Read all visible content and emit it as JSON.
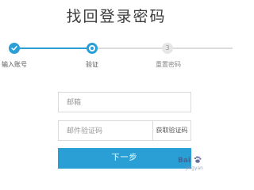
{
  "page": {
    "title": "找回登录密码"
  },
  "steps": [
    {
      "label": "输入账号",
      "state": "done",
      "icon": "check-icon"
    },
    {
      "label": "验证",
      "state": "active"
    },
    {
      "label": "重置密码",
      "state": "pending",
      "number": "3"
    }
  ],
  "form": {
    "email_placeholder": "邮箱",
    "code_placeholder": "邮件验证码",
    "get_code_label": "获取验证码",
    "next_label": "下一步"
  },
  "colors": {
    "accent": "#2a9fd6",
    "inactive": "#dcdcdc",
    "border": "#d9d9d9"
  },
  "watermark": {
    "text": "Bai",
    "sub": "jingyan",
    "icon": "baidu-paw-icon"
  }
}
